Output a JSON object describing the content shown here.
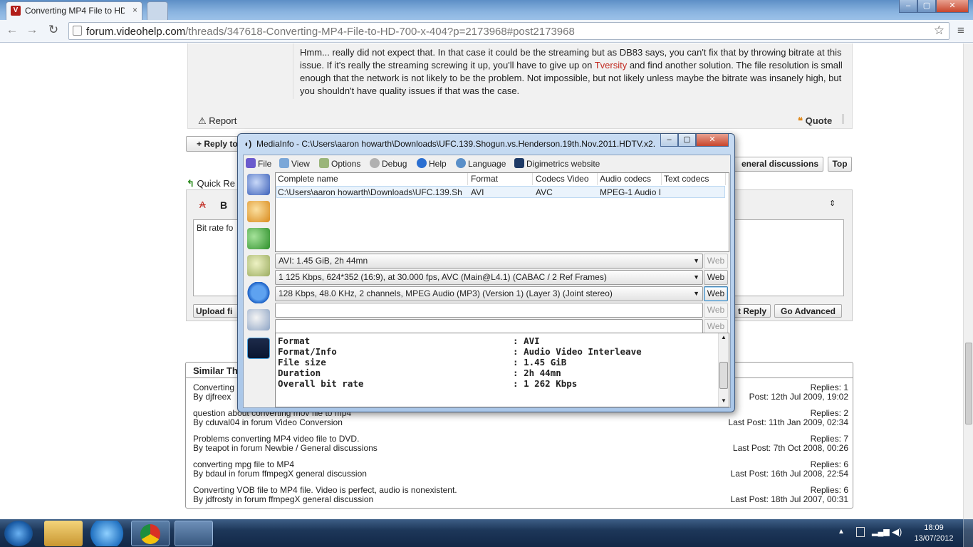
{
  "browser": {
    "tab_title": "Converting MP4 File to HD",
    "tab_favicon": "V",
    "tab_close": "×",
    "url_host": "forum.videohelp.com",
    "url_path": "/threads/347618-Converting-MP4-File-to-HD-700-x-404?p=2173968#post2173968",
    "window_controls": [
      "–",
      "▢",
      "✕"
    ]
  },
  "post": {
    "text_before_link": "Hmm... really did not expect that. In that case it could be the streaming but as DB83 says, you can't fix that by throwing bitrate at this issue. If it's really the streaming screwing it up, you'll have to give up on ",
    "link_text": "Tversity",
    "text_after_link": " and find another solution. The file resolution is small enough that the network is not likely to be the problem. Not impossible, but not likely unless maybe the bitrate was insanely high, but you shouldn't have quality issues if that was the case.",
    "report_label": "Report",
    "quote_label": "Quote"
  },
  "forum_controls": {
    "reply_label": "Reply to",
    "general_discussions_label": "eneral discussions",
    "top_label": "Top",
    "quick_reply_label": "Quick Re",
    "bold_label": "B",
    "editor_text": "Bit rate fo",
    "upload_label": "Upload fi",
    "post_reply_label": "t Reply",
    "go_advanced_label": "Go Advanced",
    "similar_threads_label": "Similar Th"
  },
  "similar_threads": [
    {
      "title": "Converting",
      "by": "By djfreex",
      "replies": "Replies: 1",
      "last_post": "Post: 12th Jul 2009, 19:02"
    },
    {
      "title": "question about converting mov file to mp4",
      "by": "By cduval04 in forum Video Conversion",
      "replies": "Replies: 2",
      "last_post": "Last Post: 11th Jan 2009, 02:34"
    },
    {
      "title": "Problems converting MP4 video file to DVD.",
      "by": "By teapot in forum Newbie / General discussions",
      "replies": "Replies: 7",
      "last_post": "Last Post: 7th Oct 2008, 00:26"
    },
    {
      "title": "converting mpg file to MP4",
      "by": "By bdaul in forum ffmpegX general discussion",
      "replies": "Replies: 6",
      "last_post": "Last Post: 16th Jul 2008, 22:54"
    },
    {
      "title": "Converting VOB file to MP4 file. Video is perfect, audio is nonexistent.",
      "by": "By jdfrosty in forum ffmpegX general discussion",
      "replies": "Replies: 6",
      "last_post": "Last Post: 18th Jul 2007, 00:31"
    }
  ],
  "mediainfo": {
    "title": "MediaInfo - C:\\Users\\aaron howarth\\Downloads\\UFC.139.Shogun.vs.Henderson.19th.Nov.2011.HDTV.x2...",
    "window_controls": [
      "–",
      "▢",
      "✕"
    ],
    "menu": [
      "File",
      "View",
      "Options",
      "Debug",
      "Help",
      "Language",
      "Digimetrics website"
    ],
    "columns": [
      "Complete name",
      "Format",
      "Codecs Video",
      "Audio codecs",
      "Text codecs"
    ],
    "row": [
      "C:\\Users\\aaron howarth\\Downloads\\UFC.139.Sh",
      "AVI",
      "AVC",
      "MPEG-1 Audio L",
      ""
    ],
    "streams": [
      {
        "text": "AVI: 1.45 GiB, 2h 44mn",
        "web": "Web",
        "web_enabled": false
      },
      {
        "text": "1 125 Kbps, 624*352 (16:9), at 30.000 fps, AVC (Main@L4.1) (CABAC / 2 Ref Frames)",
        "web": "Web",
        "web_enabled": true
      },
      {
        "text": "128 Kbps, 48.0 KHz, 2 channels, MPEG Audio (MP3) (Version 1) (Layer 3) (Joint stereo)",
        "web": "Web",
        "web_enabled": true
      },
      {
        "text": "",
        "web": "Web",
        "web_enabled": false
      },
      {
        "text": "",
        "web": "Web",
        "web_enabled": false
      }
    ],
    "info": [
      {
        "key": "Format",
        "value": "AVI"
      },
      {
        "key": "Format/Info",
        "value": "Audio Video Interleave"
      },
      {
        "key": "File size",
        "value": "1.45 GiB"
      },
      {
        "key": "Duration",
        "value": "2h 44mn"
      },
      {
        "key": "Overall bit rate",
        "value": "1 262 Kbps"
      }
    ]
  },
  "taskbar": {
    "time": "18:09",
    "date": "13/07/2012"
  }
}
